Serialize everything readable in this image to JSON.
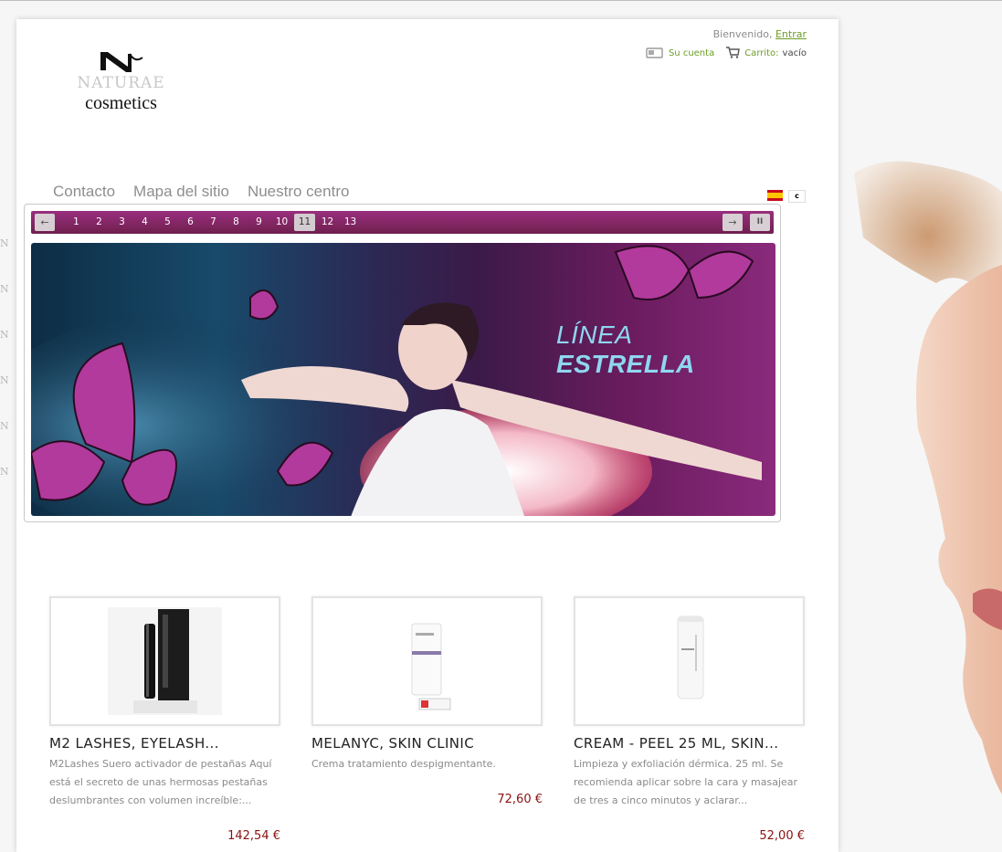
{
  "header": {
    "logo_word": "NATURAE",
    "logo_sub": "cosmetics",
    "welcome_text": "Bienvenido,",
    "login_link": "Entrar",
    "account_label": "Su cuenta",
    "cart_label": "Carrito:",
    "cart_value": "vacío"
  },
  "nav": {
    "items": [
      {
        "label": "Contacto"
      },
      {
        "label": "Mapa del sitio"
      },
      {
        "label": "Nuestro centro"
      }
    ]
  },
  "languages": {
    "other_label": "c"
  },
  "slider": {
    "pages": [
      "1",
      "2",
      "3",
      "4",
      "5",
      "6",
      "7",
      "8",
      "9",
      "10",
      "11",
      "12",
      "13"
    ],
    "active_page": "11",
    "prev_glyph": "←",
    "next_glyph": "→",
    "pause_glyph": "II",
    "banner_title_light": "LÍNEA",
    "banner_title_bold": "ESTRELLA"
  },
  "products": [
    {
      "name": "M2 LASHES, EYELASH...",
      "description": "M2Lashes Suero activador de pestañas Aquí está el secreto de unas hermosas pestañas deslumbrantes con volumen increíble:...",
      "price": "142,54 €"
    },
    {
      "name": "MELANYC, SKIN CLINIC",
      "description": "Crema tratamiento despigmentante.",
      "price": "72,60 €"
    },
    {
      "name": "CREAM - PEEL 25 ML, SKIN...",
      "description": "Limpieza y exfoliación dérmica. 25 ml. Se recomienda aplicar sobre la cara y masajear de tres a cinco minutos y aclarar...",
      "price": "52,00 €"
    }
  ],
  "colors": {
    "link_green": "#6d9d27",
    "price_red": "#8b1010",
    "slider_bar": "#7d2460",
    "banner_title": "#8fd6f0"
  }
}
